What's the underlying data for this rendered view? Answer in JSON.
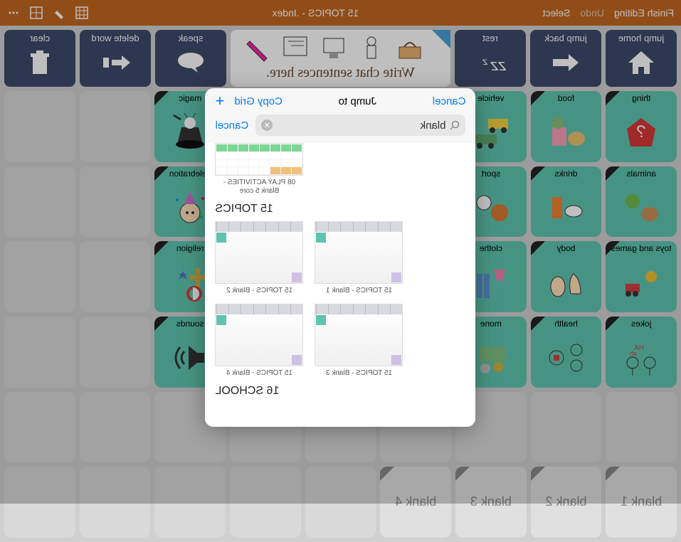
{
  "topbar": {
    "finish_editing": "Finish Editing",
    "undo": "Undo",
    "select": "Select",
    "title": "15 TOPICS - .Index"
  },
  "toolbar": {
    "jump_home": "jump home",
    "jump_back": "jump back",
    "rest": "rest",
    "compose_text": "Write chat sentences here.",
    "speak": "speak",
    "delete_word": "delete word",
    "clear": "clear"
  },
  "grid": {
    "row1": [
      "thing",
      "food",
      "vehicle",
      "",
      "",
      "",
      "magic",
      "",
      ""
    ],
    "row2": [
      "animals",
      "drinks",
      "sport",
      "",
      "",
      "",
      "celebration",
      "",
      ""
    ],
    "row3": [
      "toys and games",
      "body",
      "clothe",
      "",
      "",
      "",
      "religion",
      "",
      ""
    ],
    "row4": [
      "jokes",
      "health",
      "mone",
      "",
      "",
      "",
      "sounds",
      "",
      ""
    ],
    "row5": [
      "",
      "",
      "",
      "",
      "",
      "",
      "",
      "",
      ""
    ],
    "blanks": [
      "blank 1",
      "blank 2",
      "blank 3",
      "blank 4"
    ]
  },
  "modal": {
    "cancel": "Cancel",
    "title": "Jump to",
    "copy_grid": "Copy Grid",
    "search_value": "blank",
    "search_cancel": "Cancel",
    "result1": "08 PLAY ACTIVITIES - Blank 5 core",
    "section1": "15 TOPICS",
    "tile1": "15 TOPICS - Blank 1",
    "tile2": "15 TOPICS - Blank 2",
    "tile3": "15 TOPICS - Blank 3",
    "tile4": "15 TOPICS - Blank 4",
    "section2": "16 SCHOOL"
  }
}
